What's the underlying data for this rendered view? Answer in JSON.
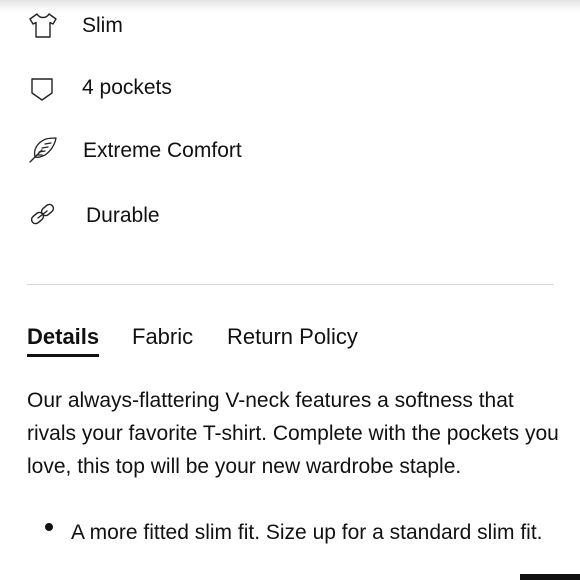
{
  "features": [
    {
      "icon": "tshirt-icon",
      "label": "Slim"
    },
    {
      "icon": "pocket-icon",
      "label": "4 pockets"
    },
    {
      "icon": "feather-icon",
      "label": "Extreme Comfort"
    },
    {
      "icon": "chain-link-icon",
      "label": "Durable"
    }
  ],
  "tabs": {
    "details": "Details",
    "fabric": "Fabric",
    "return_policy": "Return Policy",
    "active": "Details"
  },
  "description": "Our always-flattering V-neck features a softness that rivals your favorite T-shirt. Complete with the pockets you love, this top will be your new wardrobe staple.",
  "bullets": [
    "A more fitted slim fit. Size up for a standard slim fit."
  ]
}
